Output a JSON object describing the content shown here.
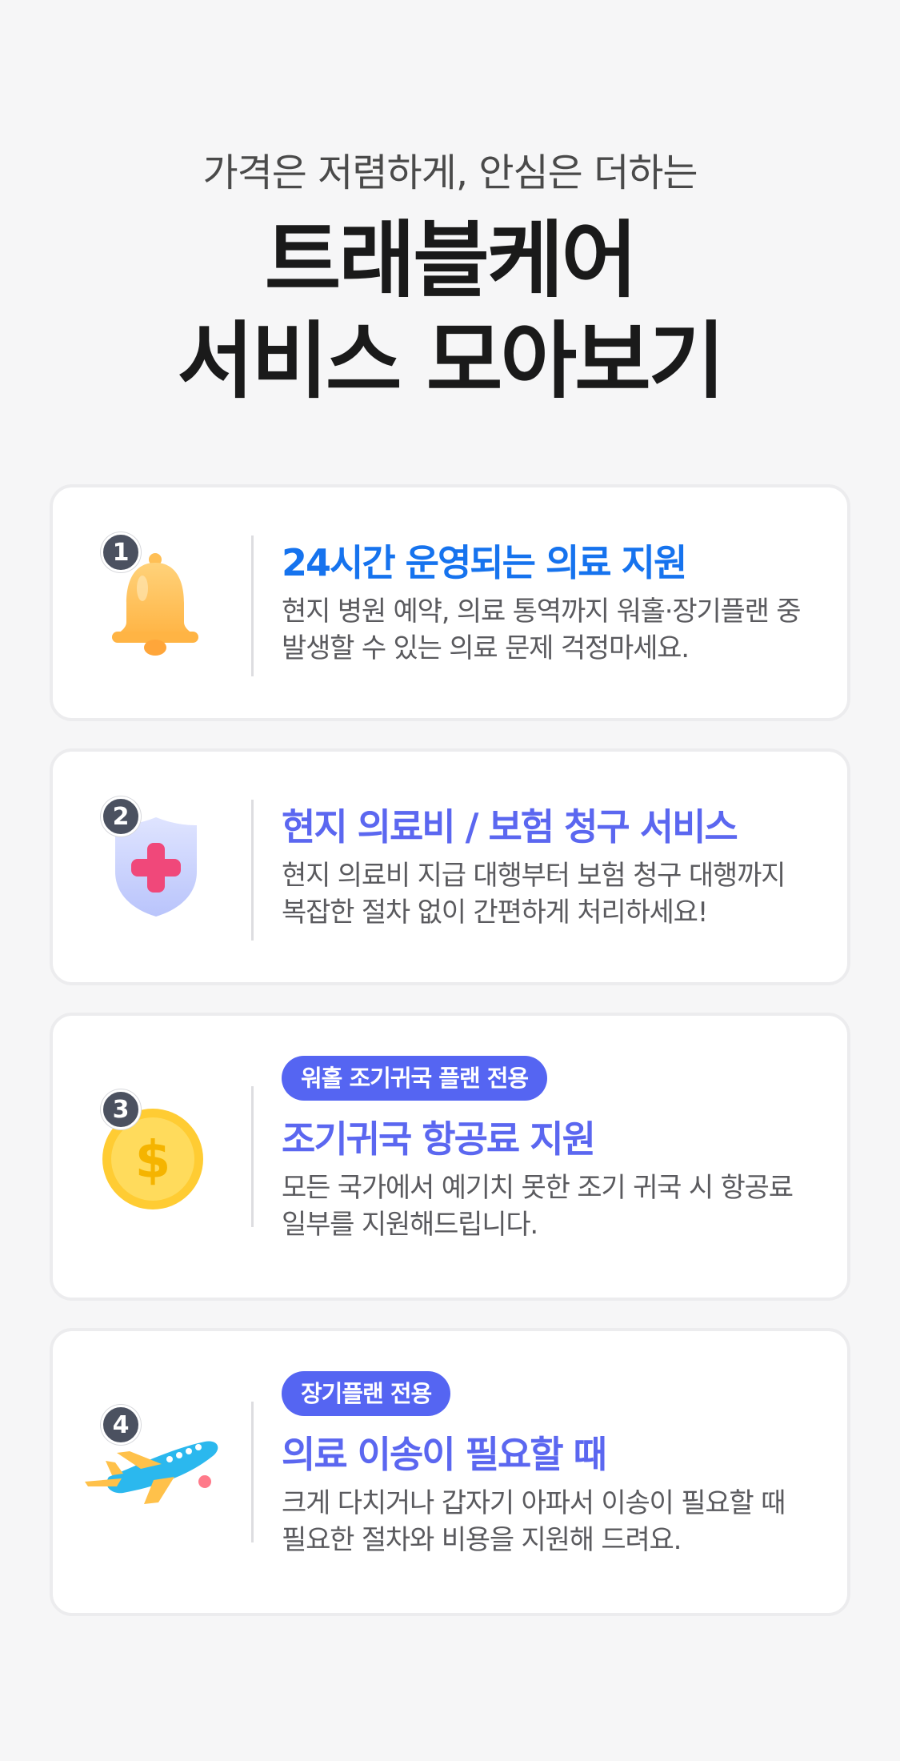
{
  "header": {
    "subtitle": "가격은 저렴하게, 안심은 더하는",
    "title_line1": "트래블케어",
    "title_line2": "서비스 모아보기"
  },
  "cards": [
    {
      "number": "1",
      "icon": "bell-icon",
      "title": "24시간 운영되는 의료 지원",
      "title_color": "#1673ee",
      "desc_line1": "현지 병원 예약, 의료 통역까지 워홀·장기플랜 중",
      "desc_line2": "발생할 수 있는 의료 문제 걱정마세요."
    },
    {
      "number": "2",
      "icon": "medical-shield-icon",
      "title": "현지 의료비 / 보험 청구 서비스",
      "title_color": "#5b67f0",
      "desc_line1": "현지 의료비 지급 대행부터 보험 청구 대행까지",
      "desc_line2": "복잡한 절차 없이 간편하게 처리하세요!"
    },
    {
      "number": "3",
      "icon": "dollar-coin-icon",
      "badge": "워홀 조기귀국 플랜 전용",
      "title": "조기귀국 항공료 지원",
      "title_color": "#5b67f0",
      "desc_line1": "모든 국가에서 예기치 못한 조기 귀국 시 항공료",
      "desc_line2": "일부를 지원해드립니다."
    },
    {
      "number": "4",
      "icon": "airplane-icon",
      "badge": "장기플랜 전용",
      "title": "의료 이송이 필요할 때",
      "title_color": "#5b67f0",
      "desc_line1": "크게 다치거나 갑자기 아파서 이송이 필요할 때",
      "desc_line2": "필요한 절차와 비용을 지원해 드려요."
    }
  ],
  "colors": {
    "background": "#f6f6f7",
    "badge": "#5565f2",
    "number_badge": "#4b5160"
  }
}
